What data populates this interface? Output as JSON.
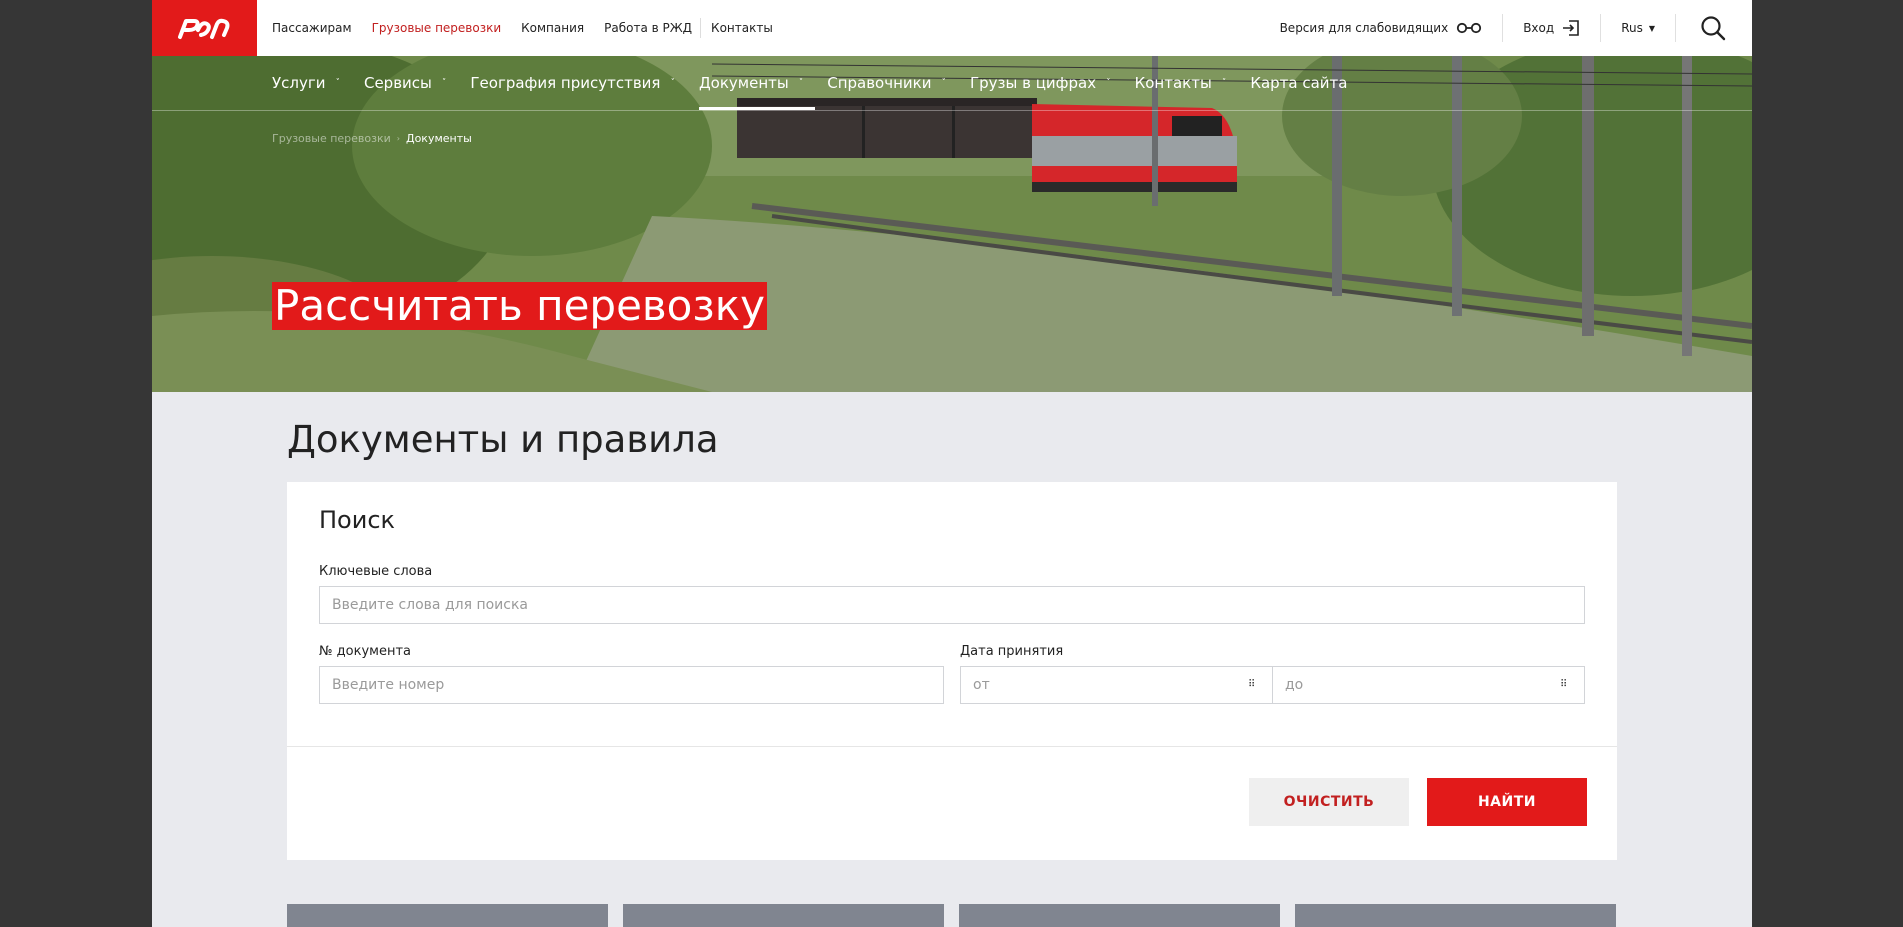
{
  "topbar": {
    "nav": [
      {
        "label": "Пассажирам",
        "active": false
      },
      {
        "label": "Грузовые перевозки",
        "active": true
      },
      {
        "label": "Компания",
        "active": false
      },
      {
        "label": "Работа в РЖД",
        "active": false
      },
      {
        "label": "Контакты",
        "active": false
      }
    ],
    "accessibility_label": "Версия для слабовидящих",
    "login_label": "Вход",
    "language_label": "Rus"
  },
  "mainnav": {
    "items": [
      {
        "label": "Услуги"
      },
      {
        "label": "Сервисы"
      },
      {
        "label": "География присутствия"
      },
      {
        "label": "Документы"
      },
      {
        "label": "Справочники"
      },
      {
        "label": "Грузы в цифрах"
      },
      {
        "label": "Контакты"
      },
      {
        "label": "Карта сайта"
      }
    ]
  },
  "breadcrumb": {
    "parent": "Грузовые перевозки",
    "current": "Документы"
  },
  "hero": {
    "title": "Рассчитать перевозку"
  },
  "page": {
    "title": "Документы и правила"
  },
  "search": {
    "heading": "Поиск",
    "keywords_label": "Ключевые слова",
    "keywords_placeholder": "Введите слова для поиска",
    "docnum_label": "№ документа",
    "docnum_placeholder": "Введите номер",
    "date_label": "Дата принятия",
    "date_from_placeholder": "от",
    "date_to_placeholder": "до",
    "clear_label": "ОЧИСТИТЬ",
    "find_label": "НАЙТИ"
  },
  "colors": {
    "brand_red": "#e21a1a",
    "page_bg": "#e9eaee",
    "outer_bg": "#363636"
  }
}
